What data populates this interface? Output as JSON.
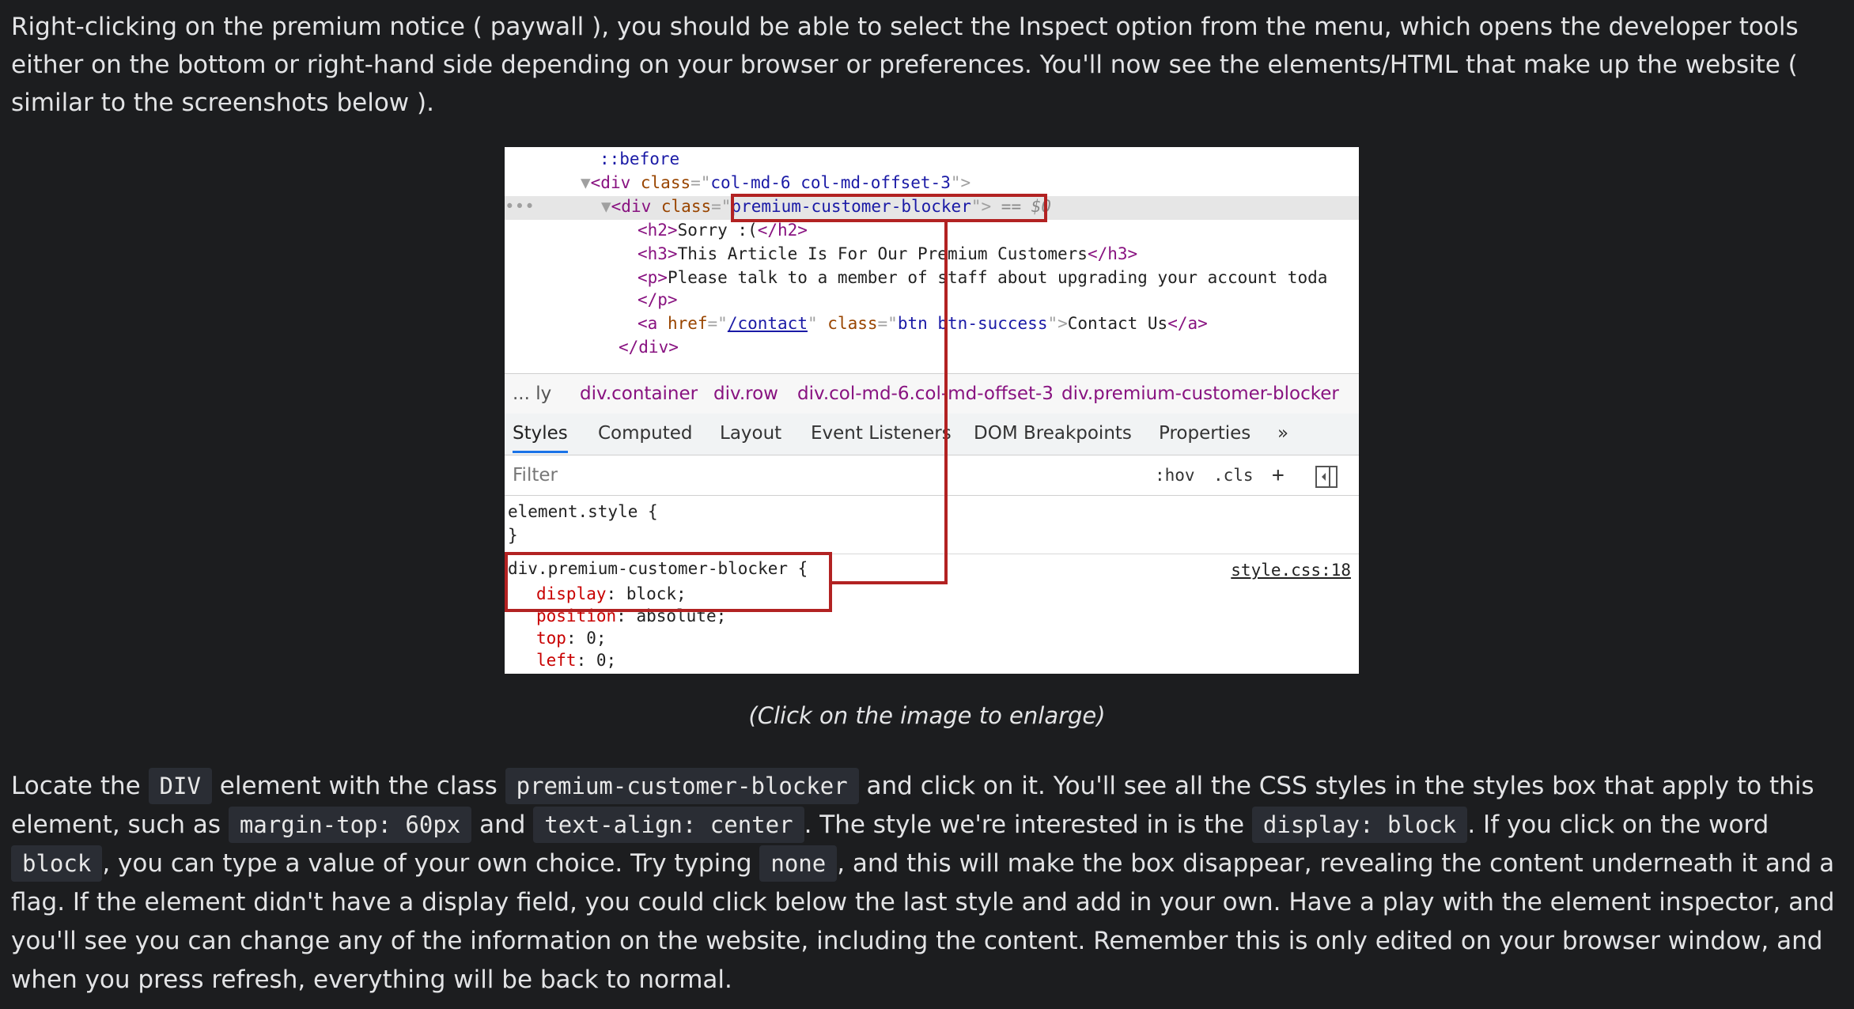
{
  "intro": {
    "text": "Right-clicking on the premium notice ( paywall ), you should be able to select the Inspect option from the menu, which opens the developer tools either on the bottom or right-hand side depending on your browser or preferences. You'll now see the elements/HTML that make up the website ( similar to the screenshots below )."
  },
  "screenshot": {
    "dom": {
      "before": "::before",
      "div1_class": "col-md-6 col-md-offset-3",
      "div2_class": "premium-customer-blocker",
      "eq": "== $0",
      "h2": "Sorry :(",
      "h3": "This Article Is For Our Premium Customers",
      "p": "Please talk to a member of staff about upgrading your account toda",
      "a_href": "/contact",
      "a_class": "btn btn-success",
      "a_text": "Contact Us"
    },
    "breadcrumbs": [
      "... ly",
      "div.container",
      "div.row",
      "div.col-md-6.col-md-offset-3",
      "div.premium-customer-blocker"
    ],
    "tabs": [
      "Styles",
      "Computed",
      "Layout",
      "Event Listeners",
      "DOM Breakpoints",
      "Properties",
      "»"
    ],
    "filter": {
      "placeholder": "Filter",
      "hov": ":hov",
      "cls": ".cls",
      "plus": "+"
    },
    "styles": {
      "element_style": "element.style {",
      "close": "}",
      "selector": "div.premium-customer-blocker {",
      "source": "style.css:18",
      "declarations": [
        {
          "prop": "display",
          "value": "block;"
        },
        {
          "prop": "position",
          "value": "absolute;"
        },
        {
          "prop": "top",
          "value": "0;"
        },
        {
          "prop": "left",
          "value": "0;"
        }
      ]
    }
  },
  "caption": "(Click on the image to enlarge)",
  "body": {
    "t1": "Locate the ",
    "c1": "DIV",
    "t2": " element with the class ",
    "c2": "premium-customer-blocker",
    "t3": " and click on it. You'll see all the CSS styles in the styles box that apply to this element, such as ",
    "c3": "margin-top: 60px",
    "t4": " and ",
    "c4": "text-align: center",
    "t5": ". The style we're interested in is the ",
    "c5": "display: block",
    "t6": ". If you click on the word ",
    "c6": "block",
    "t7": ", you can type a value of your own choice. Try typing ",
    "c7": "none",
    "t8": ", and this will make the box disappear, revealing the content underneath it and a flag. If the element didn't have a display field, you could click below the last style and add in your own. Have a play with the element inspector, and you'll see you can change any of the information on the website, including the content. Remember this is only edited on your browser window, and when you press refresh, everything will be back to normal."
  }
}
